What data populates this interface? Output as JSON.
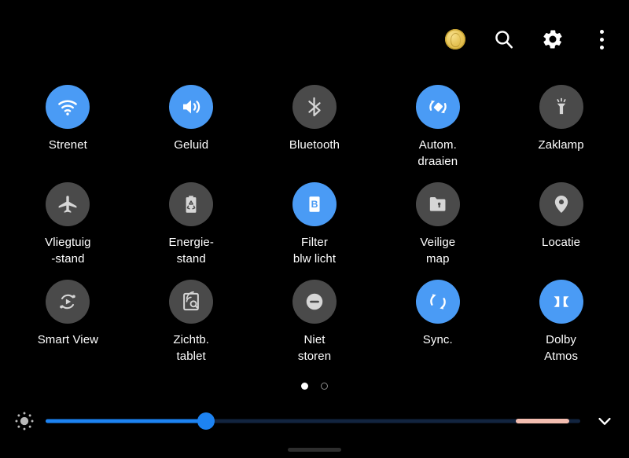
{
  "panel": {
    "background_color": "#000000",
    "accent_on_color": "#4a9bf5",
    "tile_off_color": "#4a4a4a"
  },
  "header": {
    "actions": [
      {
        "name": "rewards-coin",
        "icon": "coin-icon",
        "label": ""
      },
      {
        "name": "search",
        "icon": "search-icon",
        "label": ""
      },
      {
        "name": "settings",
        "icon": "gear-icon",
        "label": ""
      },
      {
        "name": "more-options",
        "icon": "three-dots-vertical-icon",
        "label": ""
      }
    ]
  },
  "tiles": [
    {
      "label": "Strenet",
      "icon": "wifi-icon",
      "state": "on"
    },
    {
      "label": "Geluid",
      "icon": "volume-icon",
      "state": "on"
    },
    {
      "label": "Bluetooth",
      "icon": "bluetooth-icon",
      "state": "off"
    },
    {
      "label": "Autom.\ndraaien",
      "icon": "auto-rotate-icon",
      "state": "on"
    },
    {
      "label": "Zaklamp",
      "icon": "flashlight-icon",
      "state": "off"
    },
    {
      "label": "Vliegtuig\n-stand",
      "icon": "airplane-icon",
      "state": "off"
    },
    {
      "label": "Energie-\nstand",
      "icon": "power-saving-icon",
      "state": "off"
    },
    {
      "label": "Filter\nblw licht",
      "icon": "blue-light-filter-icon",
      "state": "on"
    },
    {
      "label": "Veilige\nmap",
      "icon": "secure-folder-icon",
      "state": "off"
    },
    {
      "label": "Locatie",
      "icon": "location-pin-icon",
      "state": "off"
    },
    {
      "label": "Smart View",
      "icon": "smart-view-icon",
      "state": "off"
    },
    {
      "label": "Zichtb.\ntablet",
      "icon": "tablet-visibility-icon",
      "state": "off"
    },
    {
      "label": "Niet\nstoren",
      "icon": "do-not-disturb-icon",
      "state": "off"
    },
    {
      "label": "Sync.",
      "icon": "sync-icon",
      "state": "on"
    },
    {
      "label": "Dolby\nAtmos",
      "icon": "dolby-atmos-icon",
      "state": "on"
    }
  ],
  "pager": {
    "pages": 2,
    "active_index": 0
  },
  "brightness": {
    "icon": "brightness-sun-icon",
    "value_percent": 30,
    "range_marker_start_percent": 88,
    "range_marker_end_percent": 98,
    "fill_color": "#1d83f2",
    "track_color": "#12243f",
    "range_marker_color": "#f3bdb0",
    "expand_icon": "chevron-down-icon"
  }
}
